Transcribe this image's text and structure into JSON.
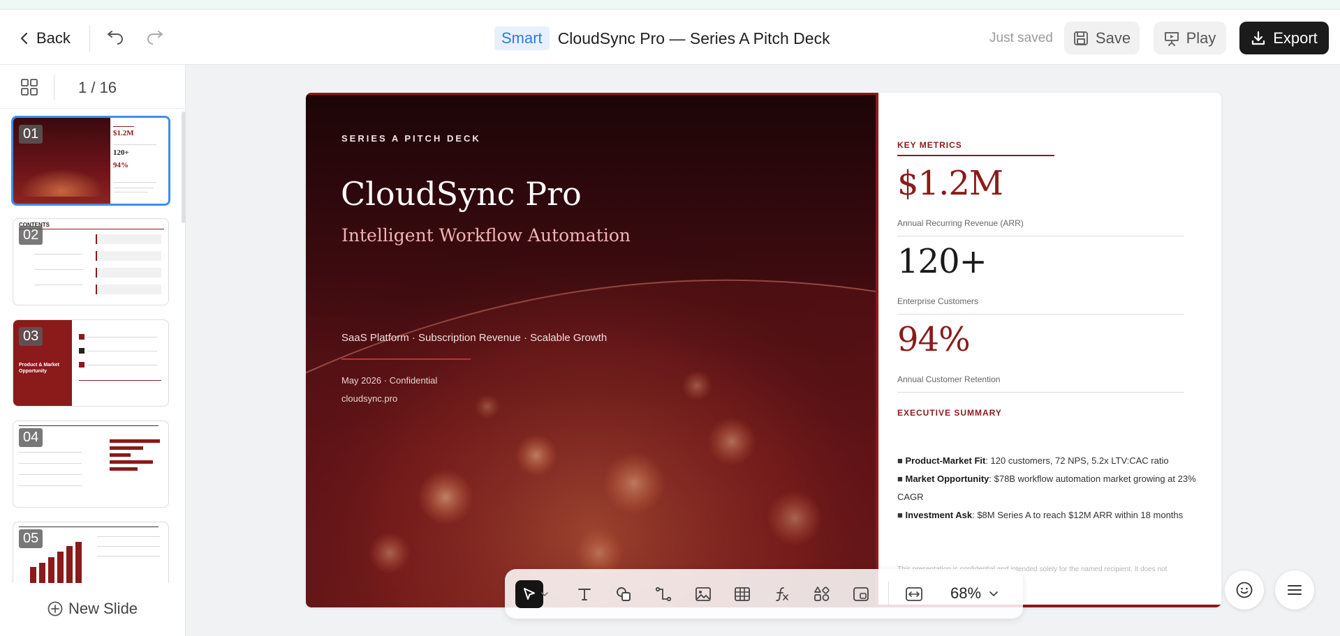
{
  "header": {
    "back_label": "Back",
    "smart_label": "Smart",
    "doc_title": "CloudSync Pro — Series A Pitch Deck",
    "saved_status": "Just saved",
    "save_label": "Save",
    "play_label": "Play",
    "export_label": "Export"
  },
  "sidebar": {
    "page_indicator": "1 / 16",
    "new_slide_label": "New Slide",
    "thumbnails": [
      {
        "number": "01",
        "selected": true
      },
      {
        "number": "02",
        "heading": "CONTENTS"
      },
      {
        "number": "03",
        "heading": "Product & Market Opportunity"
      },
      {
        "number": "04"
      },
      {
        "number": "05"
      }
    ]
  },
  "slide": {
    "eyebrow": "SERIES A PITCH DECK",
    "title": "CloudSync Pro",
    "subtitle": "Intelligent Workflow Automation",
    "tagline": "SaaS Platform · Subscription Revenue · Scalable Growth",
    "date": "May 2026 · Confidential",
    "website": "cloudsync.pro",
    "key_metrics_label": "KEY METRICS",
    "metrics": [
      {
        "value": "$1.2M",
        "label": "Annual Recurring Revenue (ARR)"
      },
      {
        "value": "120+",
        "label": "Enterprise Customers"
      },
      {
        "value": "94%",
        "label": "Annual Customer Retention"
      }
    ],
    "exec_summary_label": "EXECUTIVE SUMMARY",
    "bullets": [
      {
        "marker": "■",
        "bold": "Product-Market Fit",
        "text": ": 120 customers, 72 NPS, 5.2x LTV:CAC ratio"
      },
      {
        "marker": "■",
        "bold": "Market Opportunity",
        "text": ": $78B workflow automation market growing at 23% CAGR"
      },
      {
        "marker": "■",
        "bold": "Investment Ask",
        "text": ": $8M Series A to reach $12M ARR within 18 months"
      }
    ],
    "disclaimer": "This presentation is confidential and intended solely for the named recipient. It does not"
  },
  "toolbar": {
    "zoom": "68%",
    "tools": [
      "select",
      "text",
      "shape",
      "connector",
      "image",
      "table",
      "formula",
      "elements",
      "media",
      "fit"
    ]
  },
  "colors": {
    "accent_red": "#8b1a1a",
    "export_bg": "#1b1b1b",
    "selection_blue": "#3d8ef0",
    "smart_blue": "#2c7be0"
  }
}
